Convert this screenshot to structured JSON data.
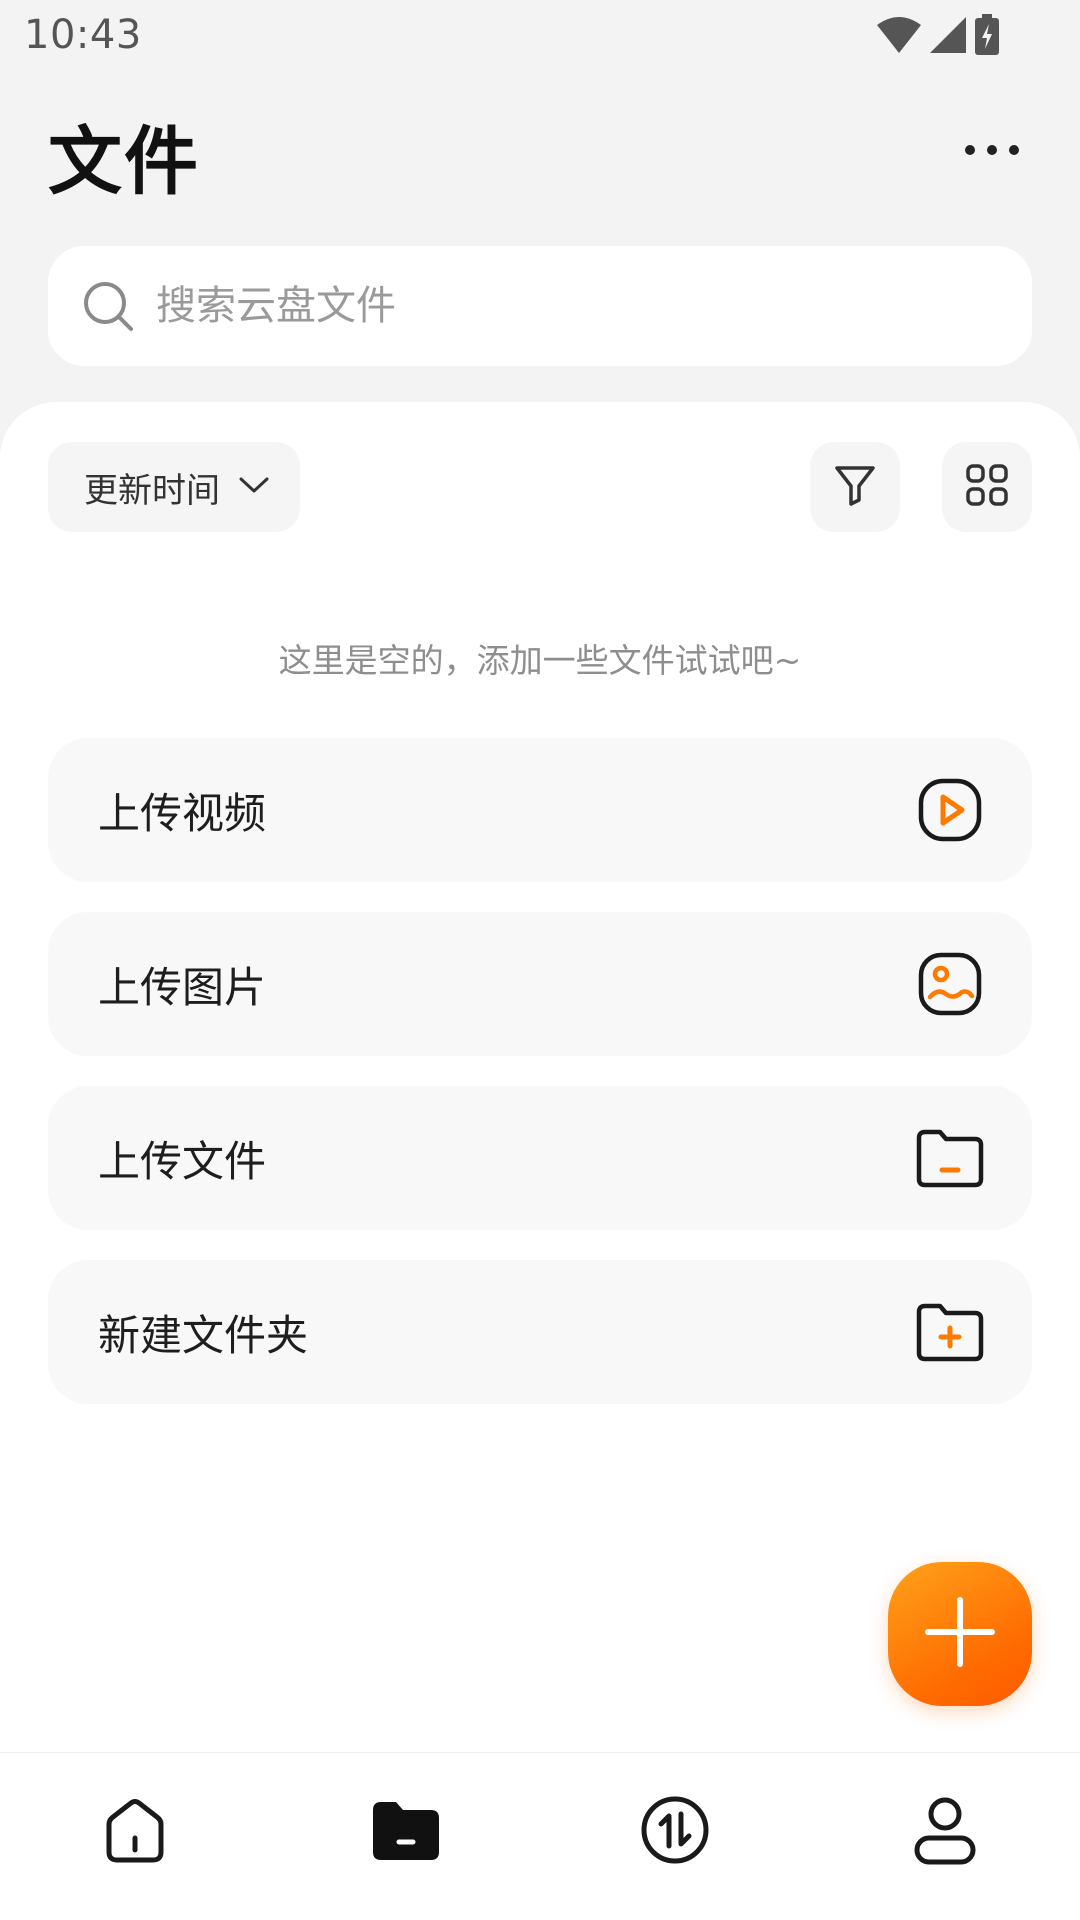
{
  "status_bar": {
    "time": "10:43",
    "icons": [
      "wifi-icon",
      "cellular-signal-icon",
      "battery-charging-icon"
    ]
  },
  "header": {
    "title": "文件",
    "more_icon": "more-horizontal-icon"
  },
  "search": {
    "placeholder": "搜索云盘文件",
    "value": "",
    "icon": "search-icon"
  },
  "toolbar": {
    "sort_label": "更新时间",
    "sort_icon": "chevron-down-icon",
    "filter_icon": "filter-icon",
    "view_icon": "grid-view-icon"
  },
  "empty_state": {
    "message": "这里是空的，添加一些文件试试吧~"
  },
  "actions": [
    {
      "label": "上传视频",
      "icon": "video-play-icon"
    },
    {
      "label": "上传图片",
      "icon": "image-icon"
    },
    {
      "label": "上传文件",
      "icon": "folder-icon"
    },
    {
      "label": "新建文件夹",
      "icon": "folder-add-icon"
    }
  ],
  "fab": {
    "icon": "plus-icon"
  },
  "bottom_nav": {
    "items": [
      {
        "icon": "home-icon",
        "active": false
      },
      {
        "icon": "files-icon",
        "active": true
      },
      {
        "icon": "transfer-icon",
        "active": false
      },
      {
        "icon": "profile-icon",
        "active": false
      }
    ]
  },
  "colors": {
    "accent": "#ff7a00",
    "background": "#f3f3f3",
    "card": "#f8f8f8",
    "text_primary": "#1b1b1b",
    "text_hint": "#8e8e8e"
  }
}
